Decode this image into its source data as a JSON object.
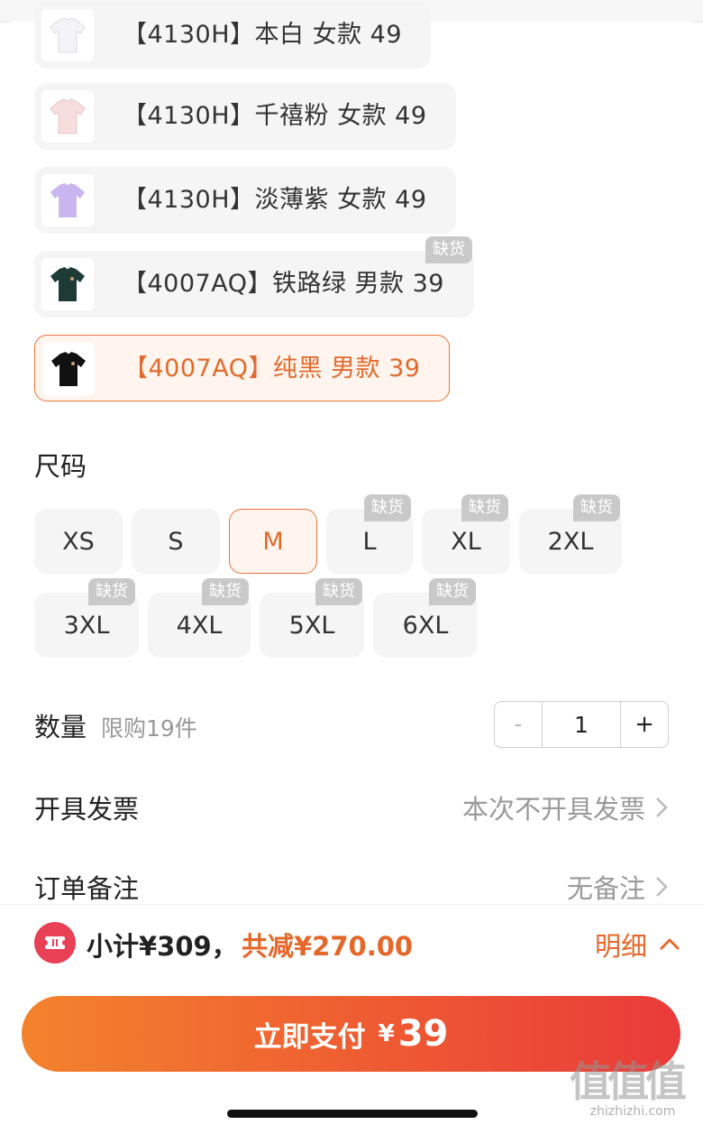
{
  "variants": [
    {
      "label": "【4130H】本白 女款 49",
      "color": "#f4f4f8"
    },
    {
      "label": "【4130H】千禧粉 女款 49",
      "color": "#f6dede"
    },
    {
      "label": "【4130H】淡薄紫 女款 49",
      "color": "#c9b6f0"
    },
    {
      "label": "【4007AQ】铁路绿 男款 39",
      "color": "#1e3b36",
      "tag": "缺货"
    },
    {
      "label": "【4007AQ】纯黑 男款 39",
      "color": "#111111",
      "selected": true
    }
  ],
  "size_section": {
    "title": "尺码",
    "sizes": [
      {
        "label": "XS"
      },
      {
        "label": "S"
      },
      {
        "label": "M",
        "selected": true
      },
      {
        "label": "L",
        "tag": "缺货"
      },
      {
        "label": "XL",
        "tag": "缺货"
      },
      {
        "label": "2XL",
        "tag": "缺货"
      },
      {
        "label": "3XL",
        "tag": "缺货"
      },
      {
        "label": "4XL",
        "tag": "缺货"
      },
      {
        "label": "5XL",
        "tag": "缺货"
      },
      {
        "label": "6XL",
        "tag": "缺货"
      }
    ]
  },
  "quantity": {
    "label": "数量",
    "limit": "限购19件",
    "value": "1",
    "minus": "-",
    "plus": "+"
  },
  "invoice": {
    "label": "开具发票",
    "value": "本次不开具发票"
  },
  "note": {
    "label": "订单备注",
    "value": "无备注"
  },
  "summary": {
    "subtotal": "小计¥309，",
    "saved": "共减¥270.00",
    "detail": "明细"
  },
  "pay_button": {
    "label": "立即支付",
    "currency": "¥",
    "amount": "39"
  },
  "watermark": {
    "big": "值值值",
    "small": "zhizhizhi.com"
  },
  "colors": {
    "accent": "#e5672a",
    "tag_bg": "#c9c9c9",
    "coupon": "#e84054"
  }
}
